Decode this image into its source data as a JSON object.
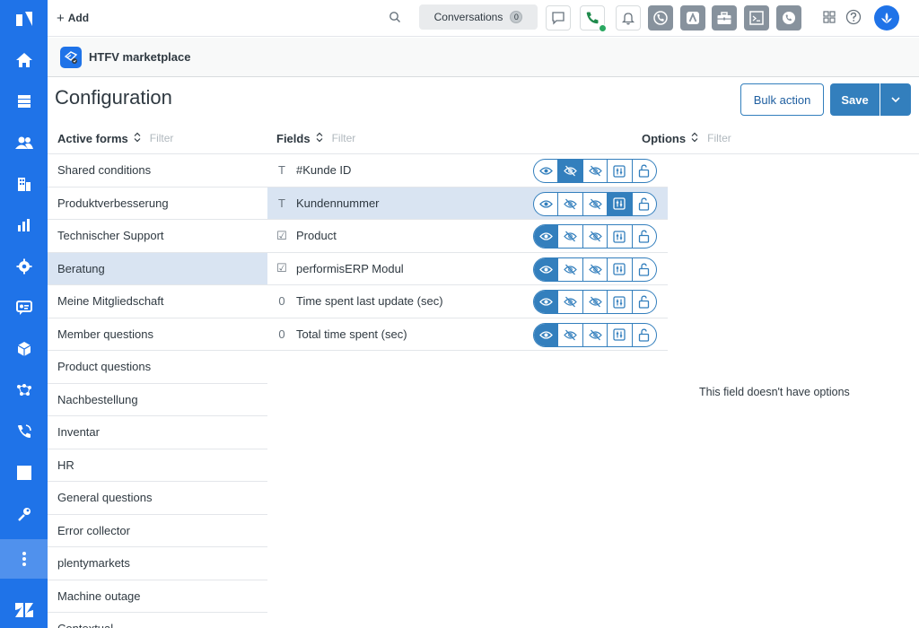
{
  "topbar": {
    "add_label": "Add",
    "conversations_label": "Conversations",
    "conversations_count": "0"
  },
  "app": {
    "name": "HTFV marketplace"
  },
  "page": {
    "title": "Configuration",
    "bulk_action_label": "Bulk action",
    "save_label": "Save"
  },
  "columns": {
    "forms_label": "Active forms",
    "fields_label": "Fields",
    "options_label": "Options",
    "filter_placeholder": "Filter"
  },
  "forms": [
    {
      "label": "Shared conditions"
    },
    {
      "label": "Produktverbesserung"
    },
    {
      "label": "Technischer Support"
    },
    {
      "label": "Beratung",
      "selected": true
    },
    {
      "label": "Meine Mitgliedschaft"
    },
    {
      "label": "Member questions"
    },
    {
      "label": "Product questions"
    },
    {
      "label": "Nachbestellung"
    },
    {
      "label": "Inventar"
    },
    {
      "label": "HR"
    },
    {
      "label": "General questions"
    },
    {
      "label": "Error collector"
    },
    {
      "label": "plentymarkets"
    },
    {
      "label": "Machine outage"
    },
    {
      "label": "Contextual"
    }
  ],
  "fields": [
    {
      "type_glyph": "T",
      "name": "#Kunde ID",
      "state": [
        false,
        true,
        false,
        false,
        false
      ]
    },
    {
      "type_glyph": "T",
      "name": "Kundennummer",
      "selected": true,
      "state": [
        false,
        false,
        false,
        true,
        false
      ]
    },
    {
      "type_glyph": "☑",
      "name": "Product",
      "state": [
        true,
        false,
        false,
        false,
        false
      ]
    },
    {
      "type_glyph": "☑",
      "name": "performisERP Modul",
      "state": [
        true,
        false,
        false,
        false,
        false
      ]
    },
    {
      "type_glyph": "0",
      "name": "Time spent last update (sec)",
      "state": [
        true,
        false,
        false,
        false,
        false
      ]
    },
    {
      "type_glyph": "0",
      "name": "Total time spent (sec)",
      "state": [
        true,
        false,
        false,
        false,
        false
      ]
    }
  ],
  "field_button_icons": [
    "eye-icon",
    "eye-slash-icon",
    "eye-slash-icon",
    "sliders-icon",
    "unlock-icon"
  ],
  "options": {
    "empty_message": "This field doesn't have options"
  },
  "colors": {
    "sidebar": "#1f73e8",
    "accent": "#337fbd",
    "selected_row": "#d9e4f2"
  }
}
